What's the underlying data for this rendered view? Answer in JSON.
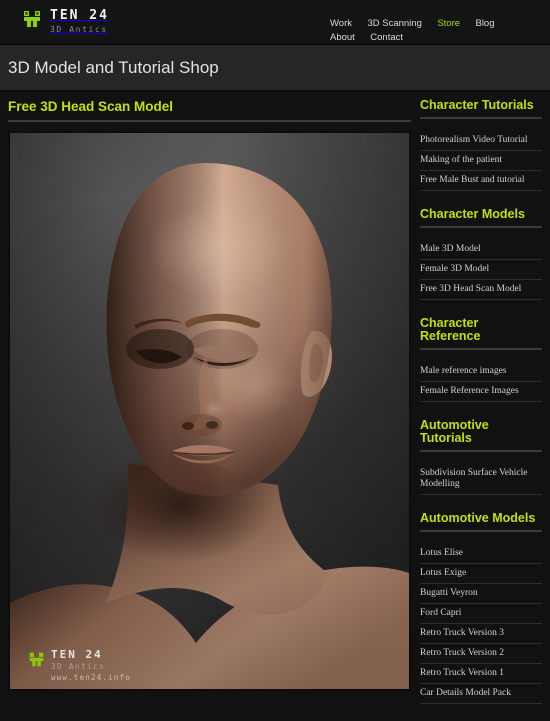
{
  "header": {
    "logo": {
      "icon": "ten24-robot-logo-icon",
      "title": "TEN 24",
      "subtitle": "3D Antics"
    },
    "nav": [
      {
        "label": "Work",
        "active": false
      },
      {
        "label": "3D Scanning",
        "active": false
      },
      {
        "label": "Store",
        "active": true
      },
      {
        "label": "Blog",
        "active": false
      },
      {
        "label": "About",
        "active": false
      },
      {
        "label": "Contact",
        "active": false
      }
    ],
    "accent_color": "#a3d818"
  },
  "page": {
    "title": "3D Model and Tutorial Shop"
  },
  "main": {
    "product_title": "Free 3D Head Scan Model",
    "image": {
      "alt": "Free 3D Head Scan Model render",
      "watermark": {
        "icon": "ten24-robot-logo-icon",
        "title": "TEN 24",
        "subtitle": "3D Antics",
        "url": "www.ten24.info"
      }
    }
  },
  "sidebar": {
    "heading_color": "#c2e009",
    "groups": [
      {
        "heading": "Character Tutorials",
        "items": [
          "Photorealism Video Tutorial",
          "Making of the patient",
          "Free Male Bust and tutorial"
        ]
      },
      {
        "heading": "Character Models",
        "items": [
          "Male 3D Model",
          "Female 3D Model",
          "Free 3D Head Scan Model"
        ]
      },
      {
        "heading": "Character Reference",
        "items": [
          "Male reference images",
          "Female Reference Images"
        ]
      },
      {
        "heading": "Automotive Tutorials",
        "items": [
          "Subdivision Surface Vehicle Modelling"
        ]
      },
      {
        "heading": "Automotive Models",
        "items": [
          "Lotus Elise",
          "Lotus Exige",
          "Bugatti Veyron",
          "Ford Capri",
          "Retro Truck Version 3",
          "Retro Truck Version 2",
          "Retro Truck Version 1",
          "Car Details Model Pack"
        ]
      }
    ]
  }
}
